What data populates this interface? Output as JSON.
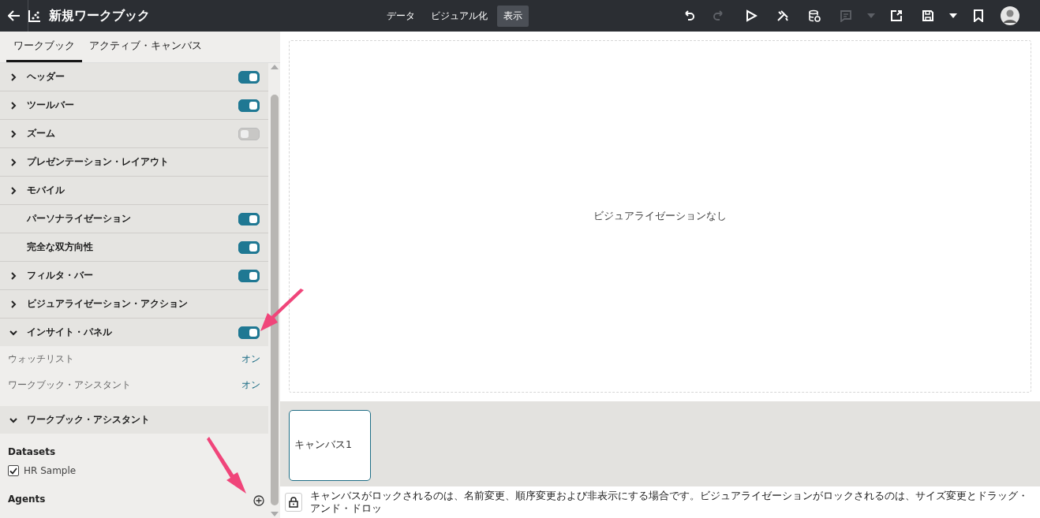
{
  "app_bar": {
    "title": "新規ワークブック",
    "modes": [
      {
        "label": "データ",
        "selected": false
      },
      {
        "label": "ビジュアル化",
        "selected": false
      },
      {
        "label": "表示",
        "selected": true
      }
    ],
    "toolbar": [
      {
        "kind": "undo",
        "disabled": false
      },
      {
        "kind": "redo",
        "disabled": true
      },
      {
        "kind": "play",
        "disabled": false
      },
      {
        "kind": "tools",
        "disabled": false
      },
      {
        "kind": "data",
        "disabled": false
      },
      {
        "kind": "comment",
        "disabled": true,
        "menu": true
      },
      {
        "kind": "export",
        "disabled": false
      },
      {
        "kind": "save",
        "disabled": false,
        "menu": true
      },
      {
        "kind": "bookmark",
        "disabled": false
      },
      {
        "kind": "avatar"
      }
    ]
  },
  "panel": {
    "tabs": [
      {
        "label": "ワークブック",
        "selected": true
      },
      {
        "label": "アクティブ・キャンバス",
        "selected": false
      }
    ],
    "sections": [
      {
        "label": "ヘッダー",
        "expanded": false,
        "kind": "toggle",
        "on": true
      },
      {
        "label": "ツールバー",
        "expanded": false,
        "kind": "toggle",
        "on": true
      },
      {
        "label": "ズーム",
        "expanded": false,
        "kind": "toggle",
        "on": false
      },
      {
        "label": "プレゼンテーション・レイアウト",
        "expanded": false,
        "kind": "plain"
      },
      {
        "label": "モバイル",
        "expanded": false,
        "kind": "plain"
      },
      {
        "label": "パーソナライゼーション",
        "kind": "toggle",
        "on": true
      },
      {
        "label": "完全な双方向性",
        "kind": "toggle",
        "on": true
      },
      {
        "label": "フィルタ・バー",
        "expanded": false,
        "kind": "toggle",
        "on": true
      },
      {
        "label": "ビジュアライゼーション・アクション",
        "expanded": false,
        "kind": "plain"
      },
      {
        "label": "インサイト・パネル",
        "expanded": true,
        "kind": "toggle",
        "on": true,
        "children": [
          {
            "label": "ウォッチリスト",
            "value": "オン"
          },
          {
            "label": "ワークブック・アシスタント",
            "value": "オン"
          }
        ]
      },
      {
        "label": "ワークブック・アシスタント",
        "expanded": true,
        "kind": "plain",
        "content": {
          "datasets_label": "Datasets",
          "datasets": [
            {
              "label": "HR Sample",
              "checked": true
            }
          ],
          "agents_label": "Agents"
        }
      }
    ]
  },
  "canvas": {
    "empty_message": "ビジュアライゼーションなし"
  },
  "canvas_tabs": [
    {
      "label": "キャンバス1",
      "selected": true
    }
  ],
  "status_bar": {
    "message": "キャンバスがロックされるのは、名前変更、順序変更および非表示にする場合です。ビジュアライゼーションがロックされるのは、サイズ変更とドラッグ・アンド・ドロッ"
  }
}
